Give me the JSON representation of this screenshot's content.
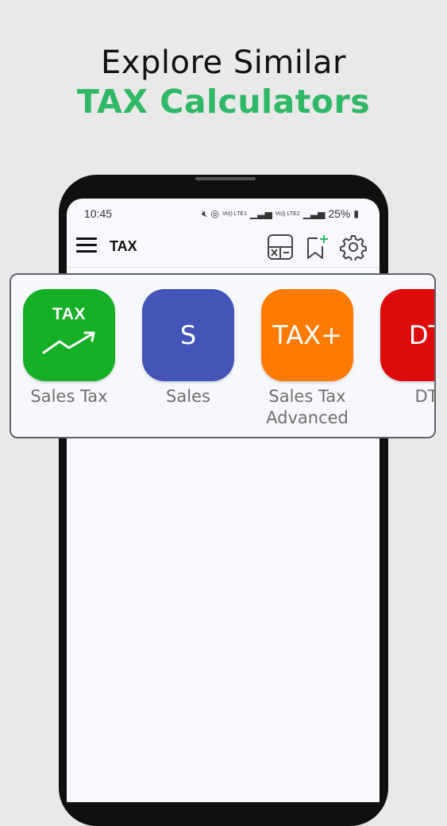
{
  "headline": {
    "line1": "Explore Similar",
    "line2": "TAX Calculators",
    "line2_color": "#2fb866"
  },
  "status_bar": {
    "time": "10:45",
    "net1": "Vo)) LTE1",
    "net2": "Vo)) LTE2",
    "battery": "25%"
  },
  "app_bar": {
    "title": "TAX",
    "icons": [
      "menu-icon",
      "calculator-icon",
      "bookmark-add-icon",
      "settings-icon"
    ]
  },
  "calculators": [
    {
      "tile_text": "TAX",
      "label": "Sales Tax",
      "color": "#15b025",
      "icon": "tax-trend-icon"
    },
    {
      "tile_text": "S",
      "label": "Sales",
      "color": "#4454b8"
    },
    {
      "tile_text": "TAX+",
      "label": "Sales Tax\nAdvanced",
      "label_line1": "Sales Tax",
      "label_line2": "Advanced",
      "color": "#ff7a00"
    },
    {
      "tile_text": "DT",
      "label": "DT",
      "color": "#dd0b0b"
    }
  ]
}
